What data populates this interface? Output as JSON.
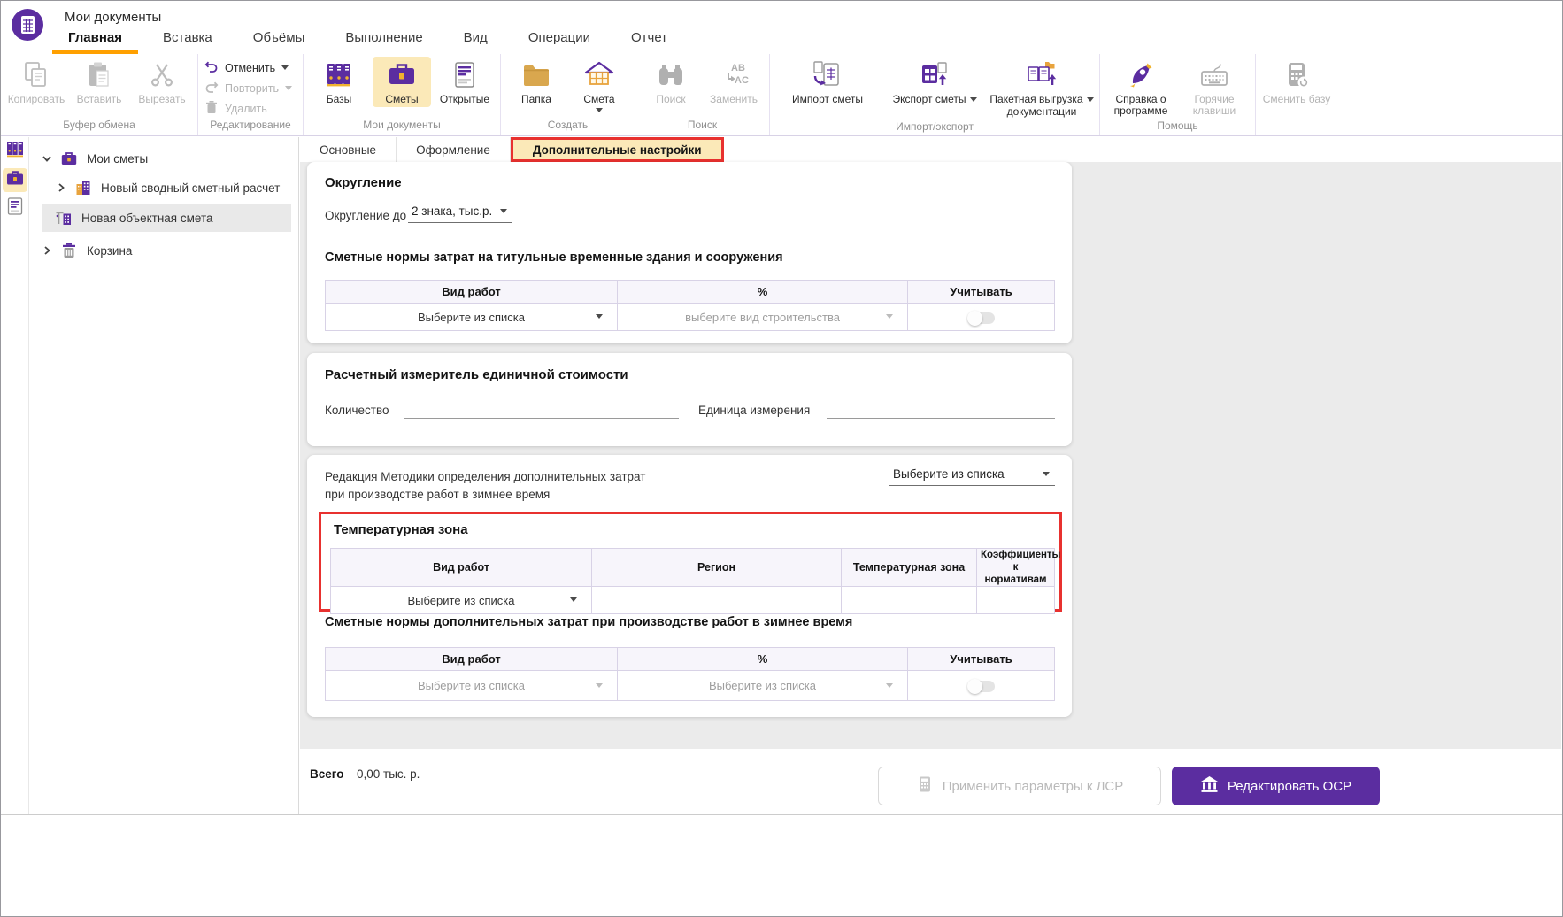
{
  "window": {
    "title": "Мои документы"
  },
  "main_tabs": [
    {
      "label": "Главная",
      "active": true
    },
    {
      "label": "Вставка"
    },
    {
      "label": "Объёмы"
    },
    {
      "label": "Выполнение"
    },
    {
      "label": "Вид"
    },
    {
      "label": "Операции"
    },
    {
      "label": "Отчет"
    }
  ],
  "ribbon": {
    "clipboard_group": {
      "label": "Буфер обмена",
      "copy": "Копировать",
      "paste": "Вставить",
      "cut": "Вырезать"
    },
    "edit_group": {
      "label": "Редактирование",
      "undo": "Отменить",
      "redo": "Повторить",
      "delete": "Удалить"
    },
    "docs_group": {
      "label": "Мои документы",
      "bases": "Базы",
      "estimates": "Сметы",
      "opened": "Открытые"
    },
    "create_group": {
      "label": "Создать",
      "folder": "Папка",
      "estimate": "Смета"
    },
    "search_group": {
      "label": "Поиск",
      "search": "Поиск",
      "replace": "Заменить"
    },
    "import_export_group": {
      "label": "Импорт/экспорт",
      "import": "Импорт сметы",
      "export": "Экспорт сметы",
      "batch_top": "Пакетная выгрузка",
      "batch_bottom": "документации"
    },
    "help_group": {
      "label": "Помощь",
      "about": "Справка о программе",
      "hotkeys": "Горячие клавиши"
    },
    "change_db": "Сменить базу"
  },
  "sidebar_tree": {
    "root": "Мои сметы",
    "summary_calc": "Новый сводный сметный расчет",
    "object_estimate": "Новая объектная смета",
    "trash": "Корзина"
  },
  "doc_tabs": [
    {
      "label": "Основные"
    },
    {
      "label": "Оформление"
    },
    {
      "label": "Дополнительные настройки",
      "active": true
    }
  ],
  "rounding_card": {
    "title": "Округление",
    "label": "Округление до",
    "value": "2 знака, тыс.р.",
    "temp_buildings_title": "Сметные нормы затрат на титульные временные здания и сооружения",
    "table": {
      "headers": [
        "Вид работ",
        "%",
        "Учитывать"
      ],
      "work_type_value": "Выберите из списка",
      "percent_placeholder": "выберите вид строительства"
    }
  },
  "unit_card": {
    "title": "Расчетный измеритель единичной стоимости",
    "quantity_label": "Количество",
    "unit_label": "Единица измерения"
  },
  "winter_card": {
    "methodology_line1": "Редакция Методики определения дополнительных затрат",
    "methodology_line2": "при производстве работ в зимнее время",
    "methodology_value": "Выберите из списка",
    "temp_zone": {
      "title": "Температурная зона",
      "headers": [
        "Вид работ",
        "Регион",
        "Температурная зона",
        "Коэффициенты к нормативам"
      ],
      "work_type_value": "Выберите из списка"
    },
    "winter_norms": {
      "title": "Сметные нормы дополнительных затрат при производстве работ в зимнее время",
      "headers": [
        "Вид работ",
        "%",
        "Учитывать"
      ],
      "work_type_placeholder": "Выберите из списка",
      "percent_placeholder": "Выберите из списка"
    }
  },
  "footer": {
    "total_label": "Всего",
    "total_value": "0,00 тыс. р.",
    "apply_button": "Применить параметры к ЛСР",
    "edit_button": "Редактировать ОСР"
  },
  "colors": {
    "accent_purple": "#5b2da0",
    "accent_orange": "#ffa000",
    "highlight_beige": "#fbe9b8",
    "annotation_red": "#e8312f",
    "content_bg": "#ebebeb"
  }
}
